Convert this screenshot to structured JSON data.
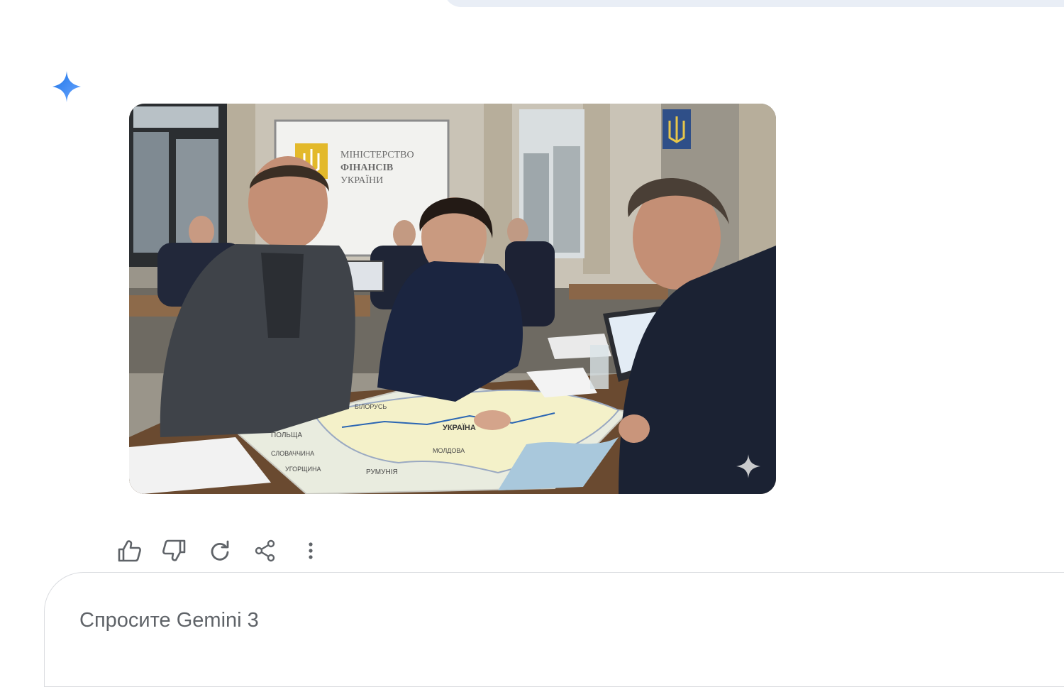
{
  "conversation": {
    "assistant_icon": "gemini-spark-icon",
    "image": {
      "description_alt": "",
      "poster_text": {
        "line1": "МІНІСТЕРСТВО",
        "line2": "ФІНАНСІВ",
        "line3": "УКРАЇНИ"
      },
      "map_labels": {
        "poland": "ПОЛЬЩА",
        "belarus": "БІЛОРУСЬ",
        "ukraine": "УКРАЇНА",
        "slovakia": "СЛОВАЧЧИНА",
        "hungary": "УГОРЩИНА",
        "moldova": "МОЛДОВА",
        "romania": "РУМУНІЯ"
      },
      "watermark_icon": "sparkle-watermark-icon"
    },
    "actions": [
      {
        "icon": "thumbs-up-icon"
      },
      {
        "icon": "thumbs-down-icon"
      },
      {
        "icon": "regenerate-icon"
      },
      {
        "icon": "share-icon"
      },
      {
        "icon": "more-vert-icon"
      }
    ]
  },
  "prompt": {
    "placeholder": "Спросите Gemini 3"
  },
  "colors": {
    "spark_blue": "#4285f4",
    "icon_gray": "#5f6368",
    "user_bubble": "#e9eef6"
  }
}
